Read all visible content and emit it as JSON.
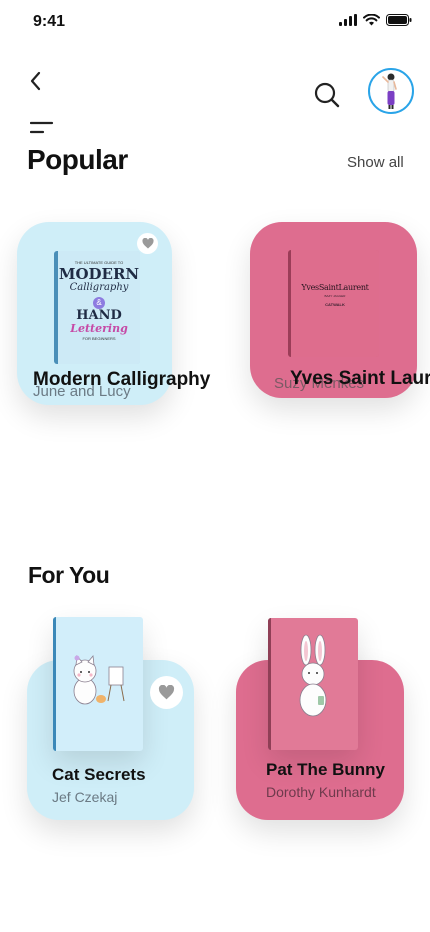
{
  "status": {
    "time": "9:41"
  },
  "popular": {
    "title": "Popular",
    "show_all": "Show all",
    "books": [
      {
        "title": "Modern Calligraphy",
        "author": "June and Lucy",
        "cover_lines": [
          "THE ULTIMATE GUIDE TO",
          "MODERN",
          "Calligraphy",
          "&",
          "HAND",
          "Lettering",
          "FOR BEGINNERS"
        ]
      },
      {
        "title": "Yves Saint Laur",
        "author": "Suzy Menkes",
        "cover_lines": [
          "YvesSaintLaurent",
          "BAZY JAGGER",
          "CATWALK"
        ]
      }
    ]
  },
  "for_you": {
    "title": "For You",
    "books": [
      {
        "title": "Cat Secrets",
        "author": "Jef Czekaj"
      },
      {
        "title": "Pat The Bunny",
        "author": "Dorothy Kunhardt"
      }
    ]
  },
  "colors": {
    "blue_card": "#cfeef8",
    "pink_card": "#de6d8f",
    "accent": "#2aa4e8"
  },
  "icons": [
    "back-icon",
    "search-icon",
    "menu-icon",
    "heart-icon",
    "signal-icon",
    "wifi-icon",
    "battery-icon"
  ]
}
